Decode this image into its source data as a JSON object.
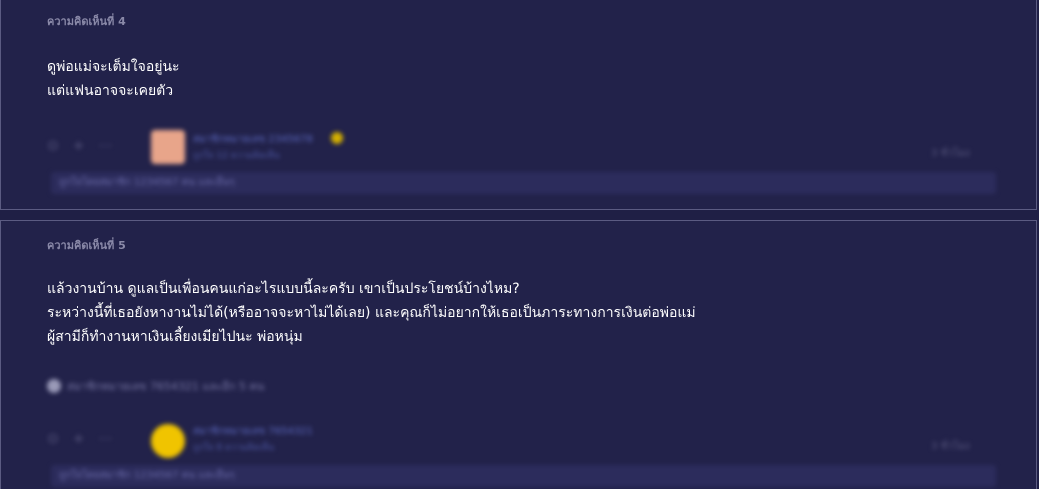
{
  "comments": [
    {
      "label": "ความคิดเห็นที่ 4",
      "lines": [
        "ดูพ่อแม่จะเต็มใจอยู่นะ",
        "แต่แฟนอาจจะเคยตัว"
      ],
      "username": "สมาชิกหมายเลข 2345678",
      "meta": "ถูกใจ 12 ความคิดเห็น",
      "time": "3 ชั่วโมง",
      "reply_bar": "ถูกใจโดยสมาชิก 1234567 คน และอื่นๆ",
      "avatar_color": "#e8a58a",
      "badge_color": "#d4b000"
    },
    {
      "label": "ความคิดเห็นที่ 5",
      "lines": [
        "แล้วงานบ้าน ดูแลเป็นเพื่อนคนแก่อะไรแบบนี้ละครับ  เขาเป็นประโยชน์บ้างไหม?",
        "ระหว่างนี้ที่เธอยังหางานไม่ได้(หรืออาจจะหาไม่ได้เลย)  และคุณก็ไม่อยากให้เธอเป็นภาระทางการเงินต่อพ่อแม่",
        "ผู้สามีก็ทำงานหาเงินเลี้ยงเมียไปนะ พ่อหนุ่ม"
      ],
      "reaction": "สมาชิกหมายเลข 7654321 และอีก 5 คน",
      "username": "สมาชิกหมายเลข 7654321",
      "meta": "ถูกใจ 8 ความคิดเห็น",
      "time": "3 ชั่วโมง",
      "reply_bar": "ถูกใจโดยสมาชิก 1234567 คน และอื่นๆ",
      "avatar_color": "#f0c400"
    }
  ],
  "icons": {
    "like": "thumbs-up-icon",
    "emoji": "emoji-icon",
    "more": "more-icon",
    "time": "clock-icon"
  }
}
